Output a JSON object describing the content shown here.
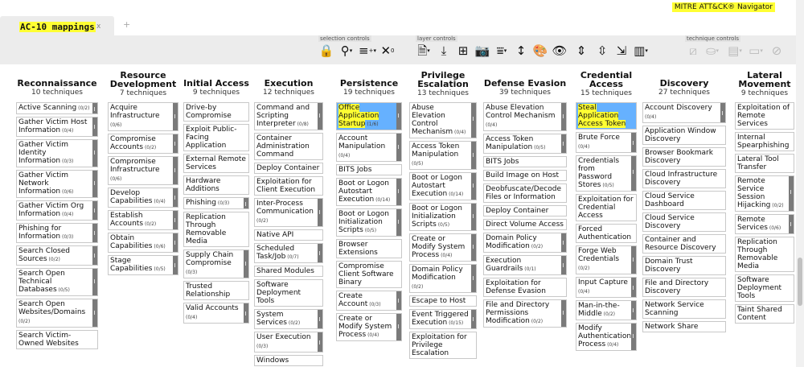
{
  "brand": "MITRE ATT&CK® Navigator",
  "tab": {
    "title": "AC-10 mappings",
    "close": "x",
    "add": "+"
  },
  "controls": {
    "selection_label": "selection controls",
    "layer_label": "layer controls",
    "technique_label": "technique controls"
  },
  "tactics": [
    {
      "name": "Reconnaissance",
      "count": "10 techniques",
      "techniques": [
        {
          "name": "Active Scanning",
          "count": "(0/2)",
          "sub": true
        },
        {
          "name": "Gather Victim Host Information",
          "count": "(0/4)",
          "sub": true
        },
        {
          "name": "Gather Victim Identity Information",
          "count": "(0/3)",
          "sub": true
        },
        {
          "name": "Gather Victim Network Information",
          "count": "(0/6)",
          "sub": true
        },
        {
          "name": "Gather Victim Org Information",
          "count": "(0/4)",
          "sub": true
        },
        {
          "name": "Phishing for Information",
          "count": "(0/3)",
          "sub": true
        },
        {
          "name": "Search Closed Sources",
          "count": "(0/2)",
          "sub": true
        },
        {
          "name": "Search Open Technical Databases",
          "count": "(0/5)",
          "sub": true
        },
        {
          "name": "Search Open Websites/Domains",
          "count": "(0/2)",
          "sub": true
        },
        {
          "name": "Search Victim-Owned Websites",
          "count": "",
          "sub": false
        }
      ]
    },
    {
      "name": "Resource Development",
      "count": "7 techniques",
      "techniques": [
        {
          "name": "Acquire Infrastructure",
          "count": "(0/6)",
          "sub": true
        },
        {
          "name": "Compromise Accounts",
          "count": "(0/2)",
          "sub": true
        },
        {
          "name": "Compromise Infrastructure",
          "count": "(0/6)",
          "sub": true
        },
        {
          "name": "Develop Capabilities",
          "count": "(0/4)",
          "sub": true
        },
        {
          "name": "Establish Accounts",
          "count": "(0/2)",
          "sub": true
        },
        {
          "name": "Obtain Capabilities",
          "count": "(0/6)",
          "sub": true
        },
        {
          "name": "Stage Capabilities",
          "count": "(0/5)",
          "sub": true
        }
      ]
    },
    {
      "name": "Initial Access",
      "count": "9 techniques",
      "techniques": [
        {
          "name": "Drive-by Compromise",
          "count": "",
          "sub": false
        },
        {
          "name": "Exploit Public-Facing Application",
          "count": "",
          "sub": false
        },
        {
          "name": "External Remote Services",
          "count": "",
          "sub": false
        },
        {
          "name": "Hardware Additions",
          "count": "",
          "sub": false
        },
        {
          "name": "Phishing",
          "count": "(0/3)",
          "sub": true
        },
        {
          "name": "Replication Through Removable Media",
          "count": "",
          "sub": false
        },
        {
          "name": "Supply Chain Compromise",
          "count": "(0/3)",
          "sub": true
        },
        {
          "name": "Trusted Relationship",
          "count": "",
          "sub": false
        },
        {
          "name": "Valid Accounts",
          "count": "(0/4)",
          "sub": true
        }
      ]
    },
    {
      "name": "Execution",
      "count": "12 techniques",
      "techniques": [
        {
          "name": "Command and Scripting Interpreter",
          "count": "(0/8)",
          "sub": true
        },
        {
          "name": "Container Administration Command",
          "count": "",
          "sub": false
        },
        {
          "name": "Deploy Container",
          "count": "",
          "sub": false
        },
        {
          "name": "Exploitation for Client Execution",
          "count": "",
          "sub": false
        },
        {
          "name": "Inter-Process Communication",
          "count": "(0/2)",
          "sub": true
        },
        {
          "name": "Native API",
          "count": "",
          "sub": false
        },
        {
          "name": "Scheduled Task/Job",
          "count": "(0/7)",
          "sub": true
        },
        {
          "name": "Shared Modules",
          "count": "",
          "sub": false
        },
        {
          "name": "Software Deployment Tools",
          "count": "",
          "sub": false
        },
        {
          "name": "System Services",
          "count": "(0/2)",
          "sub": true
        },
        {
          "name": "User Execution",
          "count": "(0/3)",
          "sub": true
        },
        {
          "name": "Windows",
          "count": "",
          "sub": false
        }
      ]
    },
    {
      "name": "Persistence",
      "count": "19 techniques",
      "techniques": [
        {
          "name": "Office Application Startup",
          "count": "(1/6)",
          "sub": true,
          "hl": true
        },
        {
          "name": "Account Manipulation",
          "count": "(0/4)",
          "sub": true
        },
        {
          "name": "BITS Jobs",
          "count": "",
          "sub": false
        },
        {
          "name": "Boot or Logon Autostart Execution",
          "count": "(0/14)",
          "sub": true
        },
        {
          "name": "Boot or Logon Initialization Scripts",
          "count": "(0/5)",
          "sub": true
        },
        {
          "name": "Browser Extensions",
          "count": "",
          "sub": false
        },
        {
          "name": "Compromise Client Software Binary",
          "count": "",
          "sub": false
        },
        {
          "name": "Create Account",
          "count": "(0/3)",
          "sub": true
        },
        {
          "name": "Create or Modify System Process",
          "count": "(0/4)",
          "sub": true
        }
      ]
    },
    {
      "name": "Privilege Escalation",
      "count": "13 techniques",
      "techniques": [
        {
          "name": "Abuse Elevation Control Mechanism",
          "count": "(0/4)",
          "sub": true
        },
        {
          "name": "Access Token Manipulation",
          "count": "(0/5)",
          "sub": true
        },
        {
          "name": "Boot or Logon Autostart Execution",
          "count": "(0/14)",
          "sub": true
        },
        {
          "name": "Boot or Logon Initialization Scripts",
          "count": "(0/5)",
          "sub": true
        },
        {
          "name": "Create or Modify System Process",
          "count": "(0/4)",
          "sub": true
        },
        {
          "name": "Domain Policy Modification",
          "count": "(0/2)",
          "sub": true
        },
        {
          "name": "Escape to Host",
          "count": "",
          "sub": false
        },
        {
          "name": "Event Triggered Execution",
          "count": "(0/15)",
          "sub": true
        },
        {
          "name": "Exploitation for Privilege Escalation",
          "count": "",
          "sub": false
        }
      ]
    },
    {
      "name": "Defense Evasion",
      "count": "39 techniques",
      "techniques": [
        {
          "name": "Abuse Elevation Control Mechanism",
          "count": "(0/4)",
          "sub": true
        },
        {
          "name": "Access Token Manipulation",
          "count": "(0/5)",
          "sub": true
        },
        {
          "name": "BITS Jobs",
          "count": "",
          "sub": false
        },
        {
          "name": "Build Image on Host",
          "count": "",
          "sub": false
        },
        {
          "name": "Deobfuscate/Decode Files or Information",
          "count": "",
          "sub": false
        },
        {
          "name": "Deploy Container",
          "count": "",
          "sub": false
        },
        {
          "name": "Direct Volume Access",
          "count": "",
          "sub": false
        },
        {
          "name": "Domain Policy Modification",
          "count": "(0/2)",
          "sub": true
        },
        {
          "name": "Execution Guardrails",
          "count": "(0/1)",
          "sub": true
        },
        {
          "name": "Exploitation for Defense Evasion",
          "count": "",
          "sub": false
        },
        {
          "name": "File and Directory Permissions Modification",
          "count": "(0/2)",
          "sub": true
        }
      ]
    },
    {
      "name": "Credential Access",
      "count": "15 techniques",
      "techniques": [
        {
          "name": "Steal Application Access Token",
          "count": "",
          "sub": false,
          "hl": true
        },
        {
          "name": "Brute Force",
          "count": "(0/4)",
          "sub": true
        },
        {
          "name": "Credentials from Password Stores",
          "count": "(0/5)",
          "sub": true
        },
        {
          "name": "Exploitation for Credential Access",
          "count": "",
          "sub": false
        },
        {
          "name": "Forced Authentication",
          "count": "",
          "sub": false
        },
        {
          "name": "Forge Web Credentials",
          "count": "(0/2)",
          "sub": true
        },
        {
          "name": "Input Capture",
          "count": "(0/4)",
          "sub": true
        },
        {
          "name": "Man-in-the-Middle",
          "count": "(0/2)",
          "sub": true
        },
        {
          "name": "Modify Authentication Process",
          "count": "(0/4)",
          "sub": true
        }
      ]
    },
    {
      "name": "Discovery",
      "count": "27 techniques",
      "techniques": [
        {
          "name": "Account Discovery",
          "count": "(0/4)",
          "sub": true
        },
        {
          "name": "Application Window Discovery",
          "count": "",
          "sub": false
        },
        {
          "name": "Browser Bookmark Discovery",
          "count": "",
          "sub": false
        },
        {
          "name": "Cloud Infrastructure Discovery",
          "count": "",
          "sub": false
        },
        {
          "name": "Cloud Service Dashboard",
          "count": "",
          "sub": false
        },
        {
          "name": "Cloud Service Discovery",
          "count": "",
          "sub": false
        },
        {
          "name": "Container and Resource Discovery",
          "count": "",
          "sub": false
        },
        {
          "name": "Domain Trust Discovery",
          "count": "",
          "sub": false
        },
        {
          "name": "File and Directory Discovery",
          "count": "",
          "sub": false
        },
        {
          "name": "Network Service Scanning",
          "count": "",
          "sub": false
        },
        {
          "name": "Network Share",
          "count": "",
          "sub": false
        }
      ]
    },
    {
      "name": "Lateral Movement",
      "count": "9 techniques",
      "techniques": [
        {
          "name": "Exploitation of Remote Services",
          "count": "",
          "sub": false
        },
        {
          "name": "Internal Spearphishing",
          "count": "",
          "sub": false
        },
        {
          "name": "Lateral Tool Transfer",
          "count": "",
          "sub": false
        },
        {
          "name": "Remote Service Session Hijacking",
          "count": "(0/2)",
          "sub": true
        },
        {
          "name": "Remote Services",
          "count": "(0/6)",
          "sub": true
        },
        {
          "name": "Replication Through Removable Media",
          "count": "",
          "sub": false
        },
        {
          "name": "Software Deployment Tools",
          "count": "",
          "sub": false
        },
        {
          "name": "Taint Shared Content",
          "count": "",
          "sub": false
        }
      ]
    }
  ]
}
